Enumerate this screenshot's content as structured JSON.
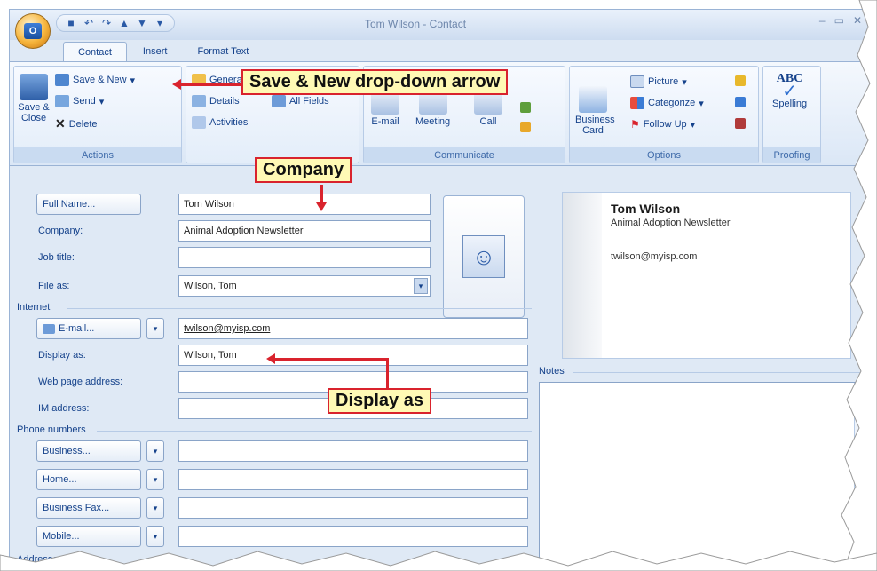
{
  "window": {
    "title": "Tom Wilson - Contact"
  },
  "tabs": [
    "Contact",
    "Insert",
    "Format Text"
  ],
  "ribbon": {
    "actions": {
      "label": "Actions",
      "save_close": "Save & Close",
      "save_new": "Save & New",
      "send": "Send",
      "delete": "Delete"
    },
    "show": {
      "general": "General",
      "details": "Details",
      "all_fields": "All Fields",
      "activities": "Activities"
    },
    "communicate": {
      "label": "Communicate",
      "email": "E-mail",
      "meeting": "Meeting",
      "call": "Call"
    },
    "options": {
      "label": "Options",
      "business_card": "Business Card",
      "picture": "Picture",
      "categorize": "Categorize",
      "follow_up": "Follow Up"
    },
    "proofing": {
      "label": "Proofing",
      "abc": "ABC",
      "spelling": "Spelling"
    }
  },
  "form": {
    "full_name_btn": "Full Name...",
    "full_name": "Tom Wilson",
    "company_label": "Company:",
    "company": "Animal Adoption Newsletter",
    "job_title_label": "Job title:",
    "job_title": "",
    "file_as_label": "File as:",
    "file_as": "Wilson, Tom",
    "internet_section": "Internet",
    "email_btn": "E-mail...",
    "email": "twilson@myisp.com",
    "display_as_label": "Display as:",
    "display_as": "Wilson, Tom",
    "web_label": "Web page address:",
    "web": "",
    "im_label": "IM address:",
    "im": "",
    "phone_section": "Phone numbers",
    "phones": [
      "Business...",
      "Home...",
      "Business Fax...",
      "Mobile..."
    ],
    "addresses_section": "Addresses"
  },
  "card": {
    "name": "Tom Wilson",
    "company": "Animal Adoption Newsletter",
    "email": "twilson@myisp.com"
  },
  "notes": {
    "label": "Notes"
  },
  "callouts": {
    "save_new": "Save & New drop-down arrow",
    "company": "Company",
    "display_as": "Display as"
  },
  "colors": {
    "callout_border": "#d9232d",
    "callout_bg": "#fff9b5",
    "ribbon_text": "#15428b"
  }
}
